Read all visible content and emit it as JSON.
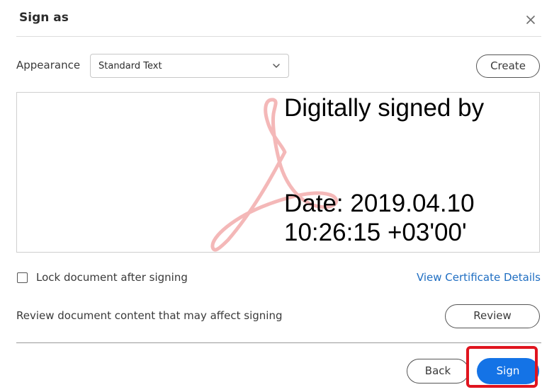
{
  "dialog": {
    "title": "Sign as"
  },
  "appearance": {
    "label": "Appearance",
    "selected": "Standard Text"
  },
  "buttons": {
    "create": "Create",
    "review": "Review",
    "back": "Back",
    "sign": "Sign"
  },
  "preview": {
    "line1": "Digitally signed by",
    "line2": "Date: 2019.04.10",
    "line3": "10:26:15 +03'00'"
  },
  "options": {
    "lock_label": "Lock document after signing",
    "lock_checked": false,
    "view_certificate": "View Certificate Details",
    "review_text": "Review document content that may affect signing"
  },
  "icons": {
    "close": "close-icon",
    "chevron": "chevron-down-icon",
    "watermark": "acrobat-logo-watermark"
  },
  "colors": {
    "primary": "#1473e6",
    "link": "#1f6ec2",
    "highlight": "#e0141e",
    "watermark": "#f4b8b8"
  }
}
